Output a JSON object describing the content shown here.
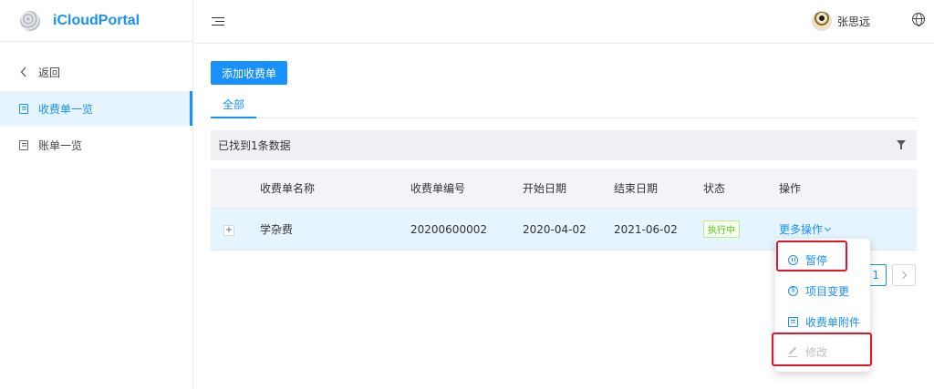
{
  "app": {
    "title": "iCloudPortal"
  },
  "sidebar": {
    "items": [
      {
        "label": "返回",
        "icon": "chevron-left-icon"
      },
      {
        "label": "收费单一览",
        "icon": "document-icon",
        "active": true
      },
      {
        "label": "账单一览",
        "icon": "document-icon"
      }
    ]
  },
  "header": {
    "user_name": "张思远"
  },
  "toolbar": {
    "add_label": "添加收费单"
  },
  "tabs": [
    {
      "label": "全部"
    }
  ],
  "result_text": "已找到1条数据",
  "table": {
    "columns": [
      "收费单名称",
      "收费单编号",
      "开始日期",
      "结束日期",
      "状态",
      "操作"
    ],
    "rows": [
      {
        "expand": "+",
        "name": "学杂费",
        "number": "20200600002",
        "start": "2020-04-02",
        "end": "2021-06-02",
        "status": "执行中",
        "op": "更多操作"
      }
    ]
  },
  "pagination": {
    "current": "1"
  },
  "dropdown": {
    "items": [
      {
        "label": "暂停",
        "icon": "pause-icon"
      },
      {
        "label": "项目变更",
        "icon": "dollar-icon"
      },
      {
        "label": "收费单附件",
        "icon": "attachment-icon"
      },
      {
        "label": "修改",
        "icon": "edit-icon",
        "disabled": true
      }
    ]
  },
  "colors": {
    "primary": "#1890ff",
    "status_green": "#52c41a",
    "highlight_red": "#e0162b",
    "row_selected": "#e6f4ff"
  }
}
